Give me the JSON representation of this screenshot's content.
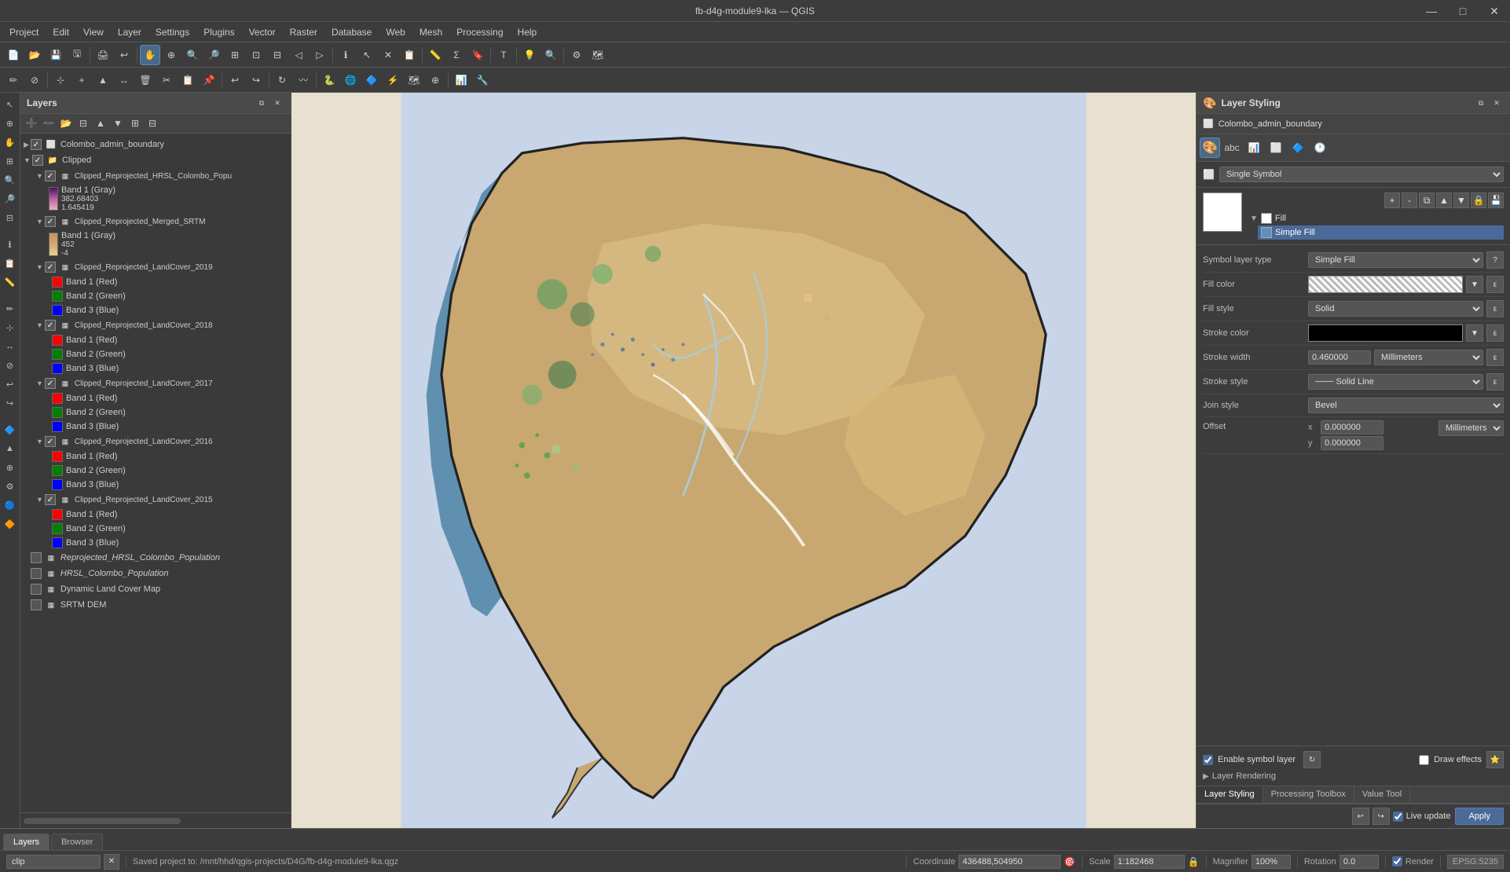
{
  "titlebar": {
    "title": "fb-d4g-module9-lka — QGIS",
    "minimize": "—",
    "maximize": "□",
    "close": "✕"
  },
  "menubar": {
    "items": [
      "Project",
      "Edit",
      "View",
      "Layer",
      "Settings",
      "Plugins",
      "Vector",
      "Raster",
      "Database",
      "Web",
      "Mesh",
      "Processing",
      "Help"
    ]
  },
  "layers_panel": {
    "title": "Layers",
    "layers": [
      {
        "id": "colombo_admin",
        "name": "Colombo_admin_boundary",
        "checked": true,
        "level": 0,
        "type": "vector"
      },
      {
        "id": "clipped_group",
        "name": "Clipped",
        "checked": true,
        "level": 0,
        "type": "group",
        "expanded": true
      },
      {
        "id": "hrsl_pop",
        "name": "Clipped_Reprojected_HRSL_Colombo_Popu",
        "checked": true,
        "level": 1,
        "type": "raster"
      },
      {
        "id": "hrsl_band",
        "name": "Band 1 (Gray)",
        "level": 2,
        "type": "band"
      },
      {
        "id": "hrsl_max",
        "name": "382.68403",
        "level": 3,
        "type": "value"
      },
      {
        "id": "hrsl_min",
        "name": "1.645419",
        "level": 3,
        "type": "value"
      },
      {
        "id": "srtm",
        "name": "Clipped_Reprojected_Merged_SRTM",
        "checked": true,
        "level": 1,
        "type": "raster"
      },
      {
        "id": "srtm_band",
        "name": "Band 1 (Gray)",
        "level": 2,
        "type": "band"
      },
      {
        "id": "srtm_max",
        "name": "452",
        "level": 3,
        "type": "value"
      },
      {
        "id": "srtm_min",
        "name": "-4",
        "level": 3,
        "type": "value"
      },
      {
        "id": "lc2019",
        "name": "Clipped_Reprojected_LandCover_2019",
        "checked": true,
        "level": 1,
        "type": "raster"
      },
      {
        "id": "lc2019_r",
        "name": "Band 1 (Red)",
        "level": 2,
        "type": "band",
        "color": "red"
      },
      {
        "id": "lc2019_g",
        "name": "Band 2 (Green)",
        "level": 2,
        "type": "band",
        "color": "green"
      },
      {
        "id": "lc2019_b",
        "name": "Band 3 (Blue)",
        "level": 2,
        "type": "band",
        "color": "blue"
      },
      {
        "id": "lc2018",
        "name": "Clipped_Reprojected_LandCover_2018",
        "checked": true,
        "level": 1,
        "type": "raster"
      },
      {
        "id": "lc2018_r",
        "name": "Band 1 (Red)",
        "level": 2,
        "type": "band",
        "color": "red"
      },
      {
        "id": "lc2018_g",
        "name": "Band 2 (Green)",
        "level": 2,
        "type": "band",
        "color": "green"
      },
      {
        "id": "lc2018_b",
        "name": "Band 3 (Blue)",
        "level": 2,
        "type": "band",
        "color": "blue"
      },
      {
        "id": "lc2017",
        "name": "Clipped_Reprojected_LandCover_2017",
        "checked": true,
        "level": 1,
        "type": "raster"
      },
      {
        "id": "lc2017_r",
        "name": "Band 1 (Red)",
        "level": 2,
        "type": "band",
        "color": "red"
      },
      {
        "id": "lc2017_g",
        "name": "Band 2 (Green)",
        "level": 2,
        "type": "band",
        "color": "green"
      },
      {
        "id": "lc2017_b",
        "name": "Band 3 (Blue)",
        "level": 2,
        "type": "band",
        "color": "blue"
      },
      {
        "id": "lc2016",
        "name": "Clipped_Reprojected_LandCover_2016",
        "checked": true,
        "level": 1,
        "type": "raster"
      },
      {
        "id": "lc2016_r",
        "name": "Band 1 (Red)",
        "level": 2,
        "type": "band",
        "color": "red"
      },
      {
        "id": "lc2016_g",
        "name": "Band 2 (Green)",
        "level": 2,
        "type": "band",
        "color": "green"
      },
      {
        "id": "lc2016_b",
        "name": "Band 3 (Blue)",
        "level": 2,
        "type": "band",
        "color": "blue"
      },
      {
        "id": "lc2015",
        "name": "Clipped_Reprojected_LandCover_2015",
        "checked": true,
        "level": 1,
        "type": "raster"
      },
      {
        "id": "lc2015_r",
        "name": "Band 1 (Red)",
        "level": 2,
        "type": "band",
        "color": "red"
      },
      {
        "id": "lc2015_g",
        "name": "Band 2 (Green)",
        "level": 2,
        "type": "band",
        "color": "green"
      },
      {
        "id": "lc2015_b",
        "name": "Band 3 (Blue)",
        "level": 2,
        "type": "band",
        "color": "blue"
      },
      {
        "id": "reprojected_hrsl",
        "name": "Reprojected_HRSL_Colombo_Population",
        "checked": false,
        "level": 0,
        "type": "raster",
        "italic": true
      },
      {
        "id": "hrsl_colombo",
        "name": "HRSL_Colombo_Population",
        "checked": false,
        "level": 0,
        "type": "raster",
        "italic": true
      },
      {
        "id": "dynamic_lc",
        "name": "Dynamic Land Cover Map",
        "checked": false,
        "level": 0,
        "type": "raster"
      },
      {
        "id": "srtm_dem",
        "name": "SRTM DEM",
        "checked": false,
        "level": 0,
        "type": "raster"
      }
    ]
  },
  "layer_styling": {
    "title": "Layer Styling",
    "layer_name": "Colombo_admin_boundary",
    "symbol_type": "Single Symbol",
    "fill_label": "Fill",
    "simple_fill_label": "Simple Fill",
    "symbol_layer_type_label": "Symbol layer type",
    "symbol_layer_type_value": "Simple Fill",
    "fill_color_label": "Fill color",
    "fill_style_label": "Fill style",
    "fill_style_value": "Solid",
    "stroke_color_label": "Stroke color",
    "stroke_width_label": "Stroke width",
    "stroke_width_value": "0.460000",
    "stroke_width_unit": "Millimeters",
    "stroke_style_label": "Stroke style",
    "stroke_style_value": "Solid Line",
    "join_style_label": "Join style",
    "join_style_value": "Bevel",
    "offset_label": "Offset",
    "offset_x": "0.000000",
    "offset_y": "0.000000",
    "offset_unit": "Millimeters",
    "enable_symbol_layer": "Enable symbol layer",
    "draw_effects": "Draw effects",
    "layer_rendering": "Layer Rendering",
    "live_update": "Live update",
    "apply_label": "Apply"
  },
  "styling_tabs": {
    "tabs": [
      "Layer Styling",
      "Processing Toolbox",
      "Value Tool"
    ],
    "active": "Layer Styling"
  },
  "statusbar": {
    "search_placeholder": "clip",
    "saved_project": "Saved project to: /mnt/hhd/qgis-projects/D4G/fb-d4g-module9-lka.qgz",
    "coordinate_label": "Coordinate",
    "coordinate_value": "436488,504950",
    "scale_label": "Scale",
    "scale_value": "1:182468",
    "magnifier_label": "Magnifier",
    "magnifier_value": "100%",
    "rotation_label": "Rotation",
    "rotation_value": "0.0",
    "render_label": "Render",
    "epsg_label": "EPSG:5235"
  },
  "bottom_tabs": {
    "tabs": [
      "Layers",
      "Browser"
    ],
    "active": "Layers"
  }
}
